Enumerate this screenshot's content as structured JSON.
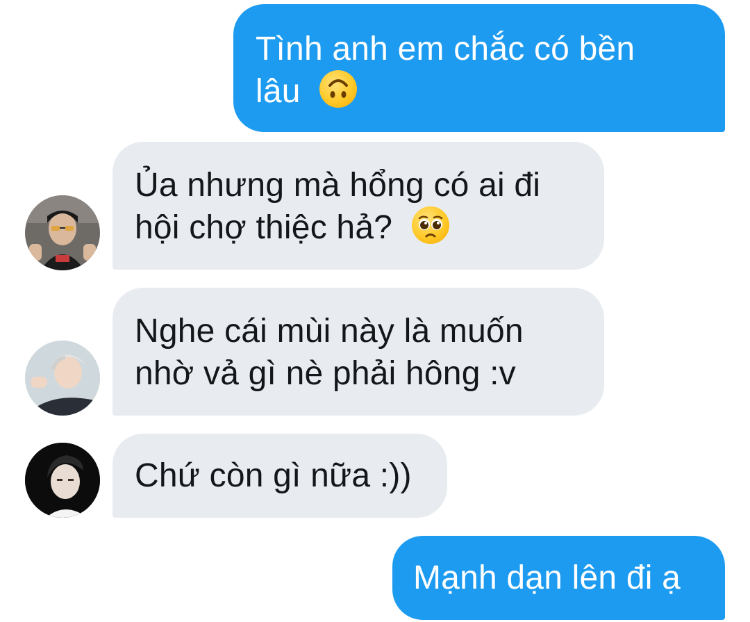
{
  "conversation": {
    "messages": [
      {
        "direction": "outgoing",
        "lines": [
          "Tình anh em chắc có bền",
          "lâu"
        ],
        "emoji": "upside-down-face-emoji"
      },
      {
        "direction": "incoming",
        "avatar": "avatar-user-1",
        "lines": [
          "Ủa nhưng mà hổng có ai đi",
          "hội chợ thiệc hả?"
        ],
        "emoji": "pleading-face-emoji"
      },
      {
        "direction": "incoming",
        "avatar": "avatar-user-2",
        "lines": [
          "Nghe cái mùi này là muốn",
          "nhờ vả gì nè phải hông :v"
        ]
      },
      {
        "direction": "incoming",
        "avatar": "avatar-user-3",
        "lines": [
          "Chứ còn gì nữa :))"
        ]
      },
      {
        "direction": "outgoing",
        "lines": [
          "Mạnh dạn lên đi ạ"
        ]
      }
    ]
  },
  "colors": {
    "outgoing_bubble": "#1d9bf0",
    "incoming_bubble": "#e8ecf0",
    "outgoing_text": "#ffffff",
    "incoming_text": "#14171a",
    "background": "#ffffff"
  }
}
